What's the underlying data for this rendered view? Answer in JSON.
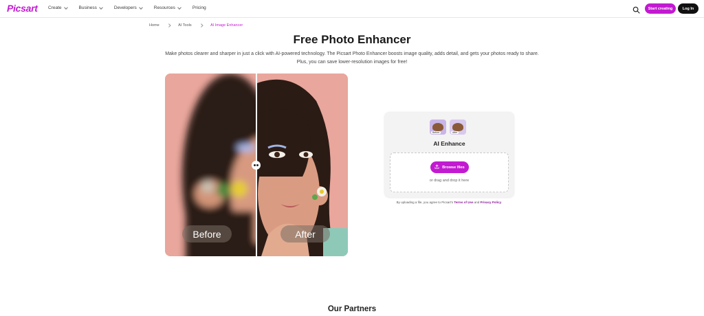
{
  "nav": {
    "logo": "Picsart",
    "menu": [
      {
        "label": "Create"
      },
      {
        "label": "Business"
      },
      {
        "label": "Developers"
      },
      {
        "label": "Resources"
      },
      {
        "label": "Pricing"
      }
    ],
    "search_icon": "search-icon",
    "start_label": "Start creating",
    "login_label": "Log In"
  },
  "breadcrumb": {
    "items": [
      "Home",
      "AI Tools",
      "AI Image Enhancer"
    ]
  },
  "hero": {
    "title": "Free Photo Enhancer",
    "description": "Make photos clearer and sharper in just a click with AI-powered technology. The Picsart Photo Enhancer boosts image quality, adds detail, and gets your photos ready to share. Plus, you can save lower-resolution images for free!"
  },
  "compare": {
    "before_label": "Before",
    "after_label": "After"
  },
  "upload": {
    "thumb_before": "Before",
    "thumb_after": "After",
    "title": "AI Enhance",
    "browse_label": "Browse files",
    "upload_icon": "upload-icon",
    "drag_text": "or drag and drop it here",
    "consent_prefix": "By uploading a file, you agree to Picsart's ",
    "terms_label": "Terms of Use",
    "consent_and": " and ",
    "privacy_label": "Privacy Policy",
    "consent_suffix": "."
  },
  "partners": {
    "title": "Our Partners"
  },
  "colors": {
    "brand": "#c21ad1",
    "dark": "#111111"
  }
}
